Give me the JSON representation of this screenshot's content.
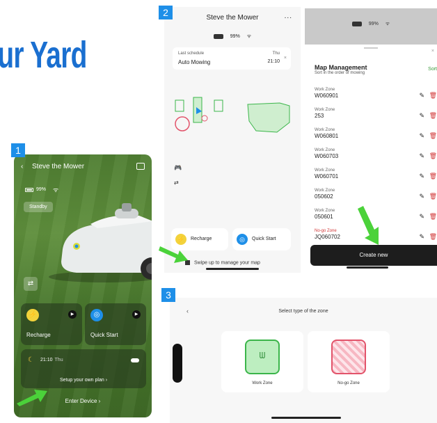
{
  "headline": "ur Yard",
  "colors": {
    "accent_blue": "#1e8fe8",
    "headline_blue": "#1a6fd0",
    "arrow_green": "#4bd23a",
    "zone_green": "#3bb54a",
    "nogo_red": "#e2536a"
  },
  "steps": {
    "one": "1",
    "two": "2",
    "three": "3"
  },
  "panel1": {
    "title": "Steve the Mower",
    "back_icon": "‹",
    "battery": "99%",
    "standby": "Standby",
    "recharge": "Recharge",
    "quick_start": "Quick Start",
    "schedule_time": "21:10",
    "schedule_day": "Thu",
    "setup_plan": "Setup your own plan ›",
    "enter_device": "Enter Device ›"
  },
  "panel2": {
    "title": "Steve the Mower",
    "more": "...",
    "battery": "99%",
    "last_schedule_label": "Last schedule",
    "last_schedule_value": "Auto Mowing",
    "last_schedule_day": "Thu",
    "last_schedule_time": "21:10",
    "close": "×",
    "recharge": "Recharge",
    "quick_start": "Quick Start",
    "swipe_hint": "Swipe up to manage your map"
  },
  "map_management": {
    "battery": "99%",
    "title": "Map Management",
    "subtitle": "Sort in the order of mowing",
    "sort": "Sort",
    "close": "×",
    "zones": [
      {
        "type": "Work Zone",
        "name": "W060901"
      },
      {
        "type": "Work Zone",
        "name": "253"
      },
      {
        "type": "Work Zone",
        "name": "W060801"
      },
      {
        "type": "Work Zone",
        "name": "W060703"
      },
      {
        "type": "Work Zone",
        "name": "W060701"
      },
      {
        "type": "Work Zone",
        "name": "050602"
      },
      {
        "type": "Work Zone",
        "name": "050601"
      },
      {
        "type": "No-go Zone",
        "name": "JQ060702"
      }
    ],
    "create_new": "Create new"
  },
  "panel3": {
    "back": "‹",
    "title": "Select type of the zone",
    "work_zone": "Work Zone",
    "no_go_zone": "No-go Zone"
  }
}
